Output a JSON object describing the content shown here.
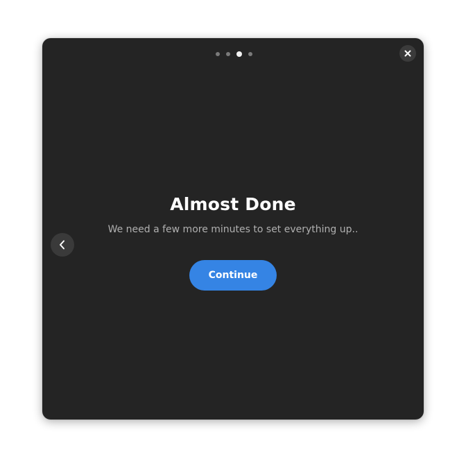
{
  "dialog": {
    "title": "Almost Done",
    "subtitle": "We need a few more minutes to set everything up..",
    "continue_label": "Continue",
    "page_indicator": {
      "total_pages": 4,
      "current_page": 3
    },
    "icons": {
      "close": "close-icon",
      "back": "chevron-left-icon"
    },
    "colors": {
      "background": "#242424",
      "accent": "#3584e4",
      "title_text": "#ffffff",
      "subtitle_text": "#b0b0b0"
    }
  }
}
